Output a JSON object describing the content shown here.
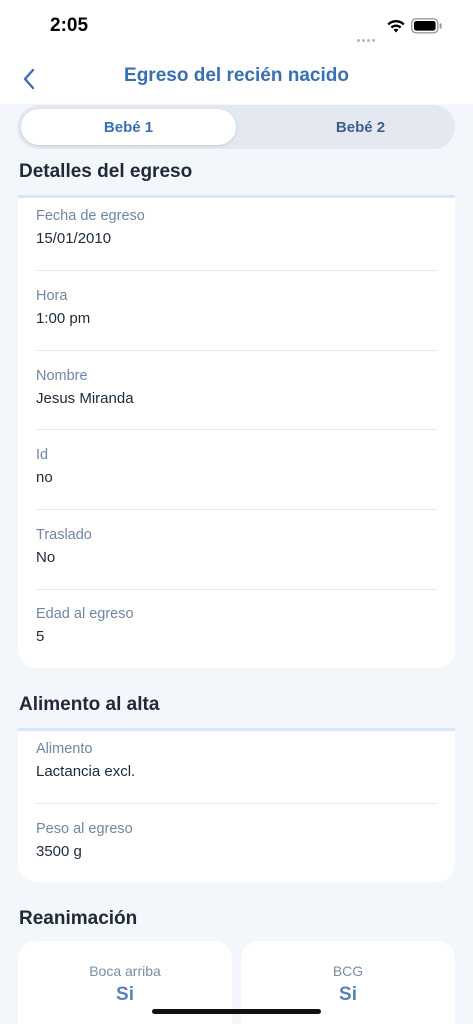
{
  "status_bar": {
    "time": "2:05"
  },
  "nav": {
    "title": "Egreso del recién nacido"
  },
  "tabs": [
    {
      "label": "Bebé 1",
      "active": true
    },
    {
      "label": "Bebé 2",
      "active": false
    }
  ],
  "egreso": {
    "title": "Detalles del egreso",
    "fields": [
      {
        "label": "Fecha de egreso",
        "value": "15/01/2010"
      },
      {
        "label": "Hora",
        "value": "1:00 pm"
      },
      {
        "label": "Nombre",
        "value": "Jesus Miranda"
      },
      {
        "label": "Id",
        "value": "no"
      },
      {
        "label": "Traslado",
        "value": "No"
      },
      {
        "label": "Edad al egreso",
        "value": "5"
      }
    ]
  },
  "alimento": {
    "title": "Alimento al alta",
    "fields": [
      {
        "label": "Alimento",
        "value": "Lactancia excl."
      },
      {
        "label": "Peso al egreso",
        "value": "3500 g"
      }
    ]
  },
  "reanimacion": {
    "title": "Reanimación",
    "tiles": [
      {
        "label": "Boca arriba",
        "value": "Si"
      },
      {
        "label": "BCG",
        "value": "Si"
      }
    ]
  },
  "colors": {
    "accent": "#3a6fb3",
    "label": "#6f87a3",
    "background": "#f3f6fb",
    "card": "#ffffff"
  }
}
